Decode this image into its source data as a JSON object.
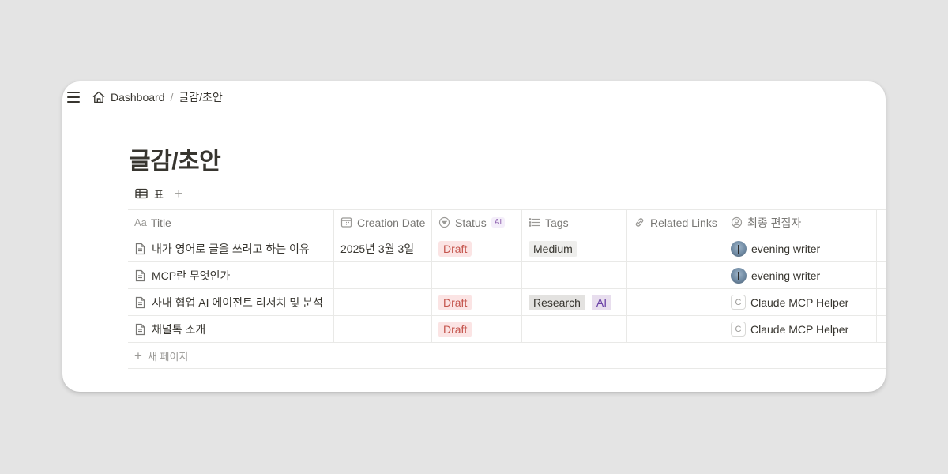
{
  "breadcrumb": {
    "home": "Dashboard",
    "separator": "/",
    "current": "글감/초안"
  },
  "page": {
    "title": "글감/초안"
  },
  "views": {
    "active_tab": "표",
    "add_label": "+"
  },
  "table": {
    "columns": {
      "title_prefix": "Aa",
      "title": "Title",
      "date": "Creation Date",
      "status": "Status",
      "status_badge": "AI",
      "tags": "Tags",
      "links": "Related Links",
      "editor": "최종 편집자"
    },
    "rows": [
      {
        "title": "내가 영어로 글을 쓰려고 하는 이유",
        "date": "2025년 3월 3일",
        "status": "Draft",
        "tags": [
          "Medium"
        ],
        "links": "",
        "editor": "evening writer",
        "editor_avatar": "photo"
      },
      {
        "title": "MCP란 무엇인가",
        "date": "",
        "status": "",
        "tags": [],
        "links": "",
        "editor": "evening writer",
        "editor_avatar": "photo"
      },
      {
        "title": "사내 협업 AI 에이전트 리서치 및 분석",
        "date": "",
        "status": "Draft",
        "tags": [
          "Research",
          "AI"
        ],
        "links": "",
        "editor": "Claude MCP Helper",
        "editor_avatar": "C"
      },
      {
        "title": "채널톡 소개",
        "date": "",
        "status": "Draft",
        "tags": [],
        "links": "",
        "editor": "Claude MCP Helper",
        "editor_avatar": "C"
      }
    ],
    "new_page_label": "새 페이지"
  },
  "colors": {
    "background": "#e4e4e4",
    "draft_bg": "#fbe4e4",
    "draft_text": "#c4554d",
    "ai_tag_bg": "#e8deee"
  }
}
